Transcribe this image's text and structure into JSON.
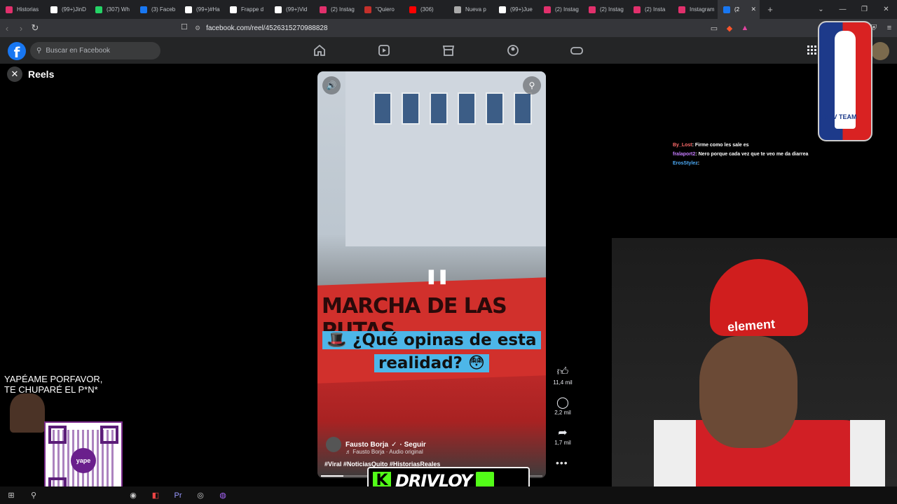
{
  "browser": {
    "tabs": [
      {
        "label": "Historias",
        "color": "#e1306c"
      },
      {
        "label": "(99+)JinD",
        "color": "#ffffff"
      },
      {
        "label": "(307) Wh",
        "color": "#25d366"
      },
      {
        "label": "(3) Faceb",
        "color": "#1877f2"
      },
      {
        "label": "(99+)#Ha",
        "color": "#ffffff"
      },
      {
        "label": "Frappe d",
        "color": "#ffffff"
      },
      {
        "label": "(99+)Vid",
        "color": "#ffffff"
      },
      {
        "label": "(2) Instag",
        "color": "#e1306c"
      },
      {
        "label": "\"Quiero",
        "color": "#c4302b"
      },
      {
        "label": "(306)",
        "color": "#ff0000"
      },
      {
        "label": "Nueva p",
        "color": "#aaaaaa"
      },
      {
        "label": "(99+)Jue",
        "color": "#ffffff"
      },
      {
        "label": "(2) Instag",
        "color": "#e1306c"
      },
      {
        "label": "(2) Instag",
        "color": "#e1306c"
      },
      {
        "label": "(2) Insta",
        "color": "#e1306c"
      },
      {
        "label": "Instagram",
        "color": "#e1306c"
      },
      {
        "label": "(2",
        "color": "#1877f2"
      }
    ],
    "new_tab": "+",
    "url": "facebook.com/reel/452631527098882​8"
  },
  "facebook": {
    "logo": "f",
    "search_placeholder": "Buscar en Facebook",
    "reels_title": "Reels"
  },
  "reel": {
    "banner_text": "MARCHA DE LAS PUTAS",
    "caption_line1": "🎩 ¿Qué opinas de esta",
    "caption_line2": "realidad? 😳",
    "author": "Fausto Borja",
    "follow": "· Seguir",
    "audio": "♬ Fausto Borja · Audio original",
    "hashtags": "#Viral #NoticiasQuito #HistoriasReales",
    "progress": 0.1,
    "likes": "11,4 mil",
    "comments": "2,2 mil",
    "shares": "1,7 mil"
  },
  "overlay": {
    "chat": [
      {
        "user": "By_Lost",
        "msg": ": Firme como les sale es",
        "color": "#ff6b6b"
      },
      {
        "user": "fralaport2",
        "msg": ": Nero porque cada vez que te veo me da diarrea",
        "color": "#c77dff"
      },
      {
        "user": "ErosStylez",
        "msg": ":",
        "color": "#4dabf7"
      }
    ],
    "driv_team": "DRIV TEAM",
    "cap_brand": "element",
    "yape_line1": "YAPÉAME PORFAVOR,",
    "yape_line2": "TE CHUPARÉ  EL P*N*",
    "qr_label": "yape",
    "streamer_k": "K",
    "streamer_name": "DRIVLOY"
  }
}
